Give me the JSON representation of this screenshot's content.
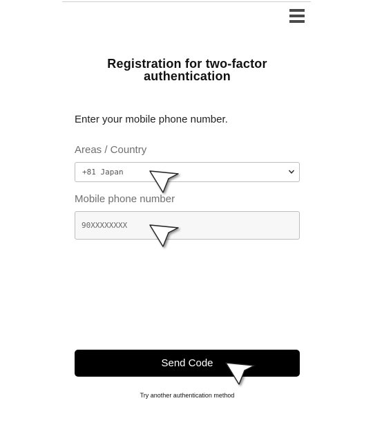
{
  "header": {
    "menu_icon": "hamburger-menu-icon"
  },
  "page": {
    "title": "Registration for two-factor authentication",
    "instruction": "Enter your mobile phone number."
  },
  "form": {
    "area_label": "Areas / Country",
    "area_selected": "+81 Japan",
    "phone_label": "Mobile phone number",
    "phone_placeholder": "90XXXXXXXX",
    "phone_value": ""
  },
  "actions": {
    "send_label": "Send Code",
    "alt_link_label": "Try another authentication method"
  },
  "colors": {
    "button_bg": "#000000",
    "button_text": "#ffffff",
    "label_gray": "#6f6f6f",
    "input_border": "#bdbdbd"
  }
}
